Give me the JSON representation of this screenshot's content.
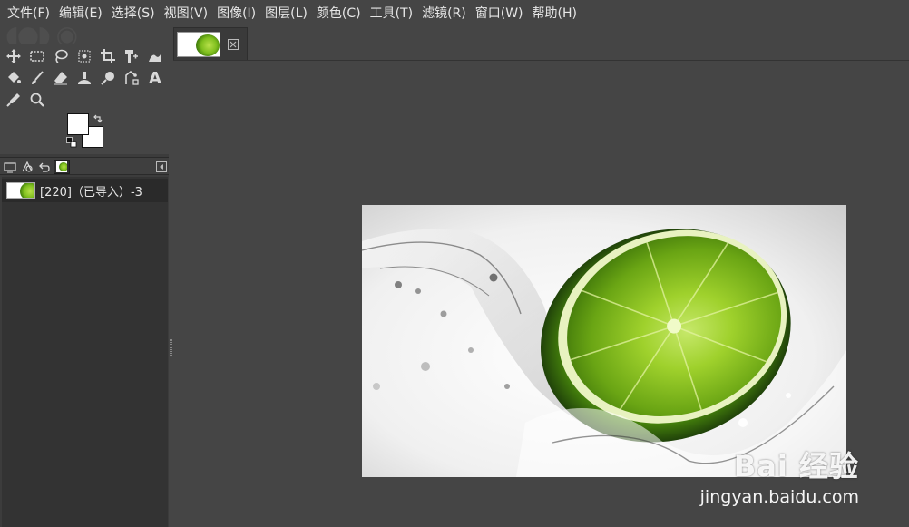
{
  "menubar": {
    "items": [
      "文件(F)",
      "编辑(E)",
      "选择(S)",
      "视图(V)",
      "图像(I)",
      "图层(L)",
      "颜色(C)",
      "工具(T)",
      "滤镜(R)",
      "窗口(W)",
      "帮助(H)"
    ]
  },
  "toolbox": {
    "tools": [
      {
        "name": "move-tool-icon"
      },
      {
        "name": "rect-select-tool-icon"
      },
      {
        "name": "free-select-tool-icon"
      },
      {
        "name": "fuzzy-select-tool-icon"
      },
      {
        "name": "crop-tool-icon"
      },
      {
        "name": "unified-transform-tool-icon"
      },
      {
        "name": "warp-transform-tool-icon"
      },
      {
        "name": "bucket-fill-tool-icon"
      },
      {
        "name": "paintbrush-tool-icon"
      },
      {
        "name": "eraser-tool-icon"
      },
      {
        "name": "clone-tool-icon"
      },
      {
        "name": "smudge-tool-icon"
      },
      {
        "name": "paths-tool-icon"
      },
      {
        "name": "text-tool-icon"
      },
      {
        "name": "color-picker-tool-icon"
      },
      {
        "name": "zoom-tool-icon"
      }
    ],
    "text_tool_glyph": "A",
    "colors": {
      "foreground": "#ffffff",
      "background": "#ffffff"
    }
  },
  "dock": {
    "tabs": [
      "tool-options-tab",
      "device-status-tab",
      "undo-history-tab",
      "images-tab"
    ],
    "images": [
      {
        "label": "[220]（已导入）-3"
      }
    ]
  },
  "canvas": {
    "tab_close_glyph": "⊠"
  },
  "watermark": {
    "logo": "Bai 经验",
    "url": "jingyan.baidu.com"
  },
  "theme": {
    "accent_green": "#7fbf1e",
    "panel_dark": "#3c3c3c",
    "canvas_bg": "#454545"
  }
}
